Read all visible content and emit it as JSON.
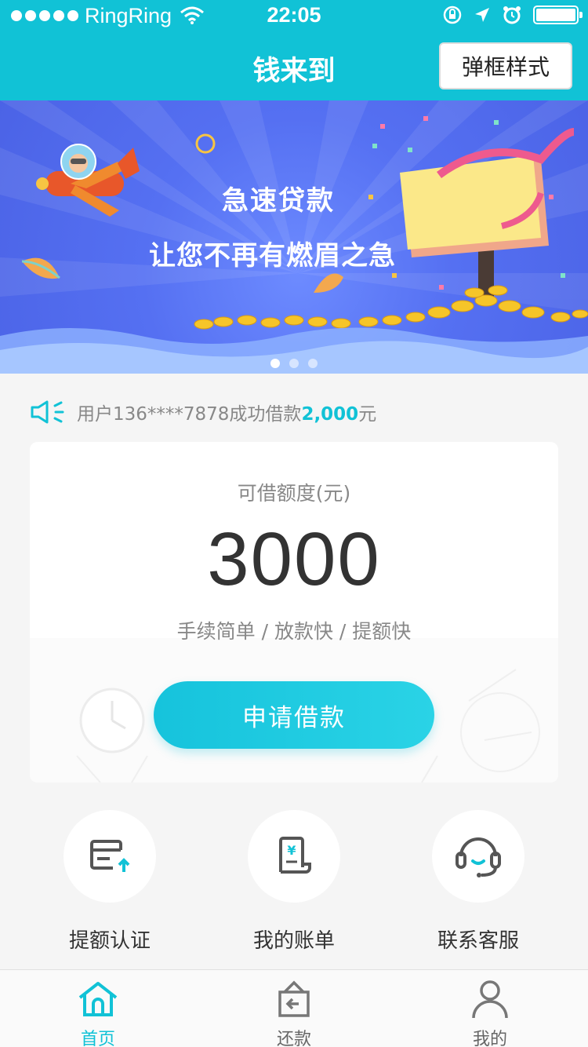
{
  "status_bar": {
    "carrier": "RingRing",
    "time": "22:05"
  },
  "nav": {
    "title": "钱来到",
    "right_button": "弹框样式"
  },
  "banner": {
    "line1": "急速贷款",
    "line2": "让您不再有燃眉之急",
    "slide_count": 3,
    "active_slide": 1
  },
  "notice": {
    "prefix": "用户136****7878成功借款",
    "amount": "2,000",
    "suffix": "元"
  },
  "loan_card": {
    "label": "可借额度(元)",
    "amount": "3000",
    "features": "手续简单 / 放款快 / 提额快",
    "apply_button": "申请借款"
  },
  "quick_actions": [
    {
      "label": "提额认证",
      "icon": "credit-card-upload-icon"
    },
    {
      "label": "我的账单",
      "icon": "bill-icon"
    },
    {
      "label": "联系客服",
      "icon": "headset-icon"
    }
  ],
  "tabbar": [
    {
      "label": "首页",
      "icon": "home-icon",
      "active": true
    },
    {
      "label": "还款",
      "icon": "repay-icon",
      "active": false
    },
    {
      "label": "我的",
      "icon": "user-icon",
      "active": false
    }
  ],
  "colors": {
    "primary": "#11c2d6",
    "banner": "#5570f2",
    "text": "#333333",
    "muted": "#888888"
  }
}
